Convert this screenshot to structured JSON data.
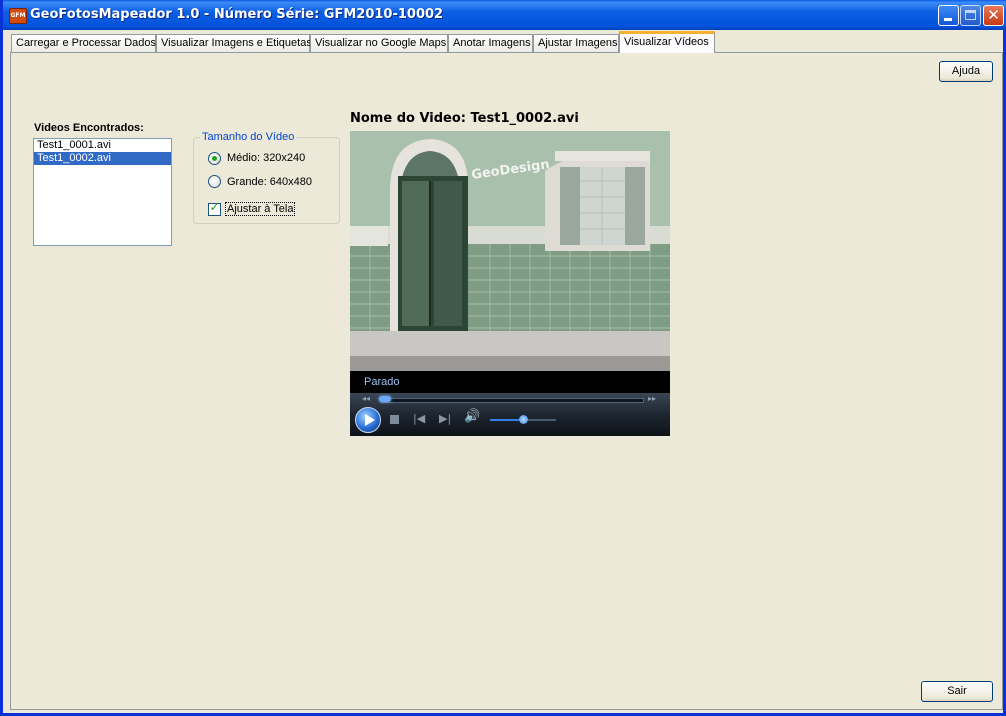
{
  "window": {
    "title": "GeoFotosMapeador 1.0 - Número Série: GFM2010-10002",
    "icon_label": "GFM",
    "icon": "app-icon",
    "controls": [
      "minimize-icon",
      "maximize-icon",
      "close-icon"
    ],
    "close_glyph": "✕"
  },
  "tabs": [
    {
      "label": "Carregar e Processar Dados",
      "active": false
    },
    {
      "label": "Visualizar Imagens e Etiquetas",
      "active": false
    },
    {
      "label": "Visualizar no Google Maps",
      "active": false
    },
    {
      "label": "Anotar Imagens",
      "active": false
    },
    {
      "label": "Ajustar Imagens",
      "active": false
    },
    {
      "label": "Visualizar Vídeos",
      "active": true
    }
  ],
  "help_button": "Ajuda",
  "exit_button": "Sair",
  "videos": {
    "label": "Videos Encontrados:",
    "items": [
      "Test1_0001.avi",
      "Test1_0002.avi"
    ],
    "selected_index": 1
  },
  "size_group": {
    "legend": "Tamanho do Vídeo",
    "options": [
      {
        "label": "Médio: 320x240",
        "checked": true
      },
      {
        "label": "Grande: 640x480",
        "checked": false
      }
    ],
    "fit_checkbox": {
      "label": "Ajustar à Tela",
      "checked": true
    },
    "check_glyph": "✓"
  },
  "player": {
    "title": "Nome do Video: Test1_0002.avi",
    "frame_watermark": "GeoDesign",
    "status": "Parado",
    "seek_position": 0.02,
    "volume": 0.5,
    "seek_back_glyph": "◂◂",
    "seek_forward_glyph": "▸▸",
    "prev_glyph": "|◀",
    "next_glyph": "▶|",
    "volume_glyph": "🔊"
  },
  "colors": {
    "titlebar": "#0a5ce8",
    "selection": "#316ac5",
    "active_tab_accent": "#f8b034",
    "groupbox_legend": "#0046d5",
    "check_green": "#21a121",
    "player_status": "#9fc3ee"
  }
}
